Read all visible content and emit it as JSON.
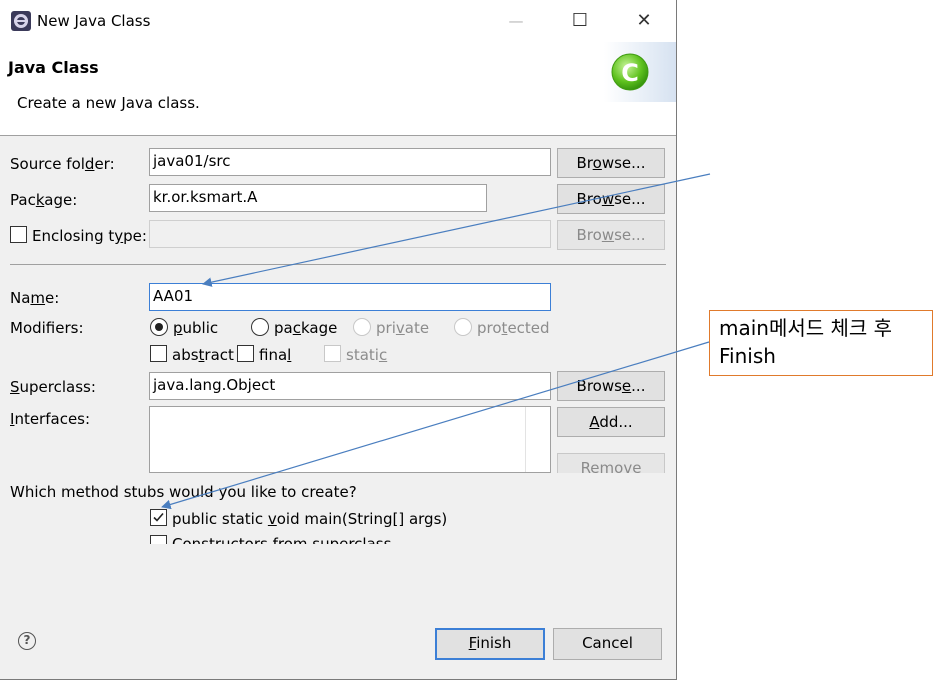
{
  "window": {
    "title": "New Java Class",
    "controls": {
      "minimize": "—",
      "maximize": "☐",
      "close": "✕"
    }
  },
  "header": {
    "title": "Java Class",
    "description": "Create a new Java class."
  },
  "form": {
    "source_folder": {
      "label": "Source folder:",
      "value": "java01/src",
      "browse": "Browse..."
    },
    "package": {
      "label": "Package:",
      "value": "kr.or.ksmart.A",
      "browse": "Browse..."
    },
    "enclosing_type": {
      "label": "Enclosing type:",
      "value": "",
      "browse": "Browse...",
      "checked": false
    },
    "name": {
      "label": "Name:",
      "value": "AA01"
    },
    "modifiers": {
      "label": "Modifiers:",
      "access": [
        {
          "label": "public",
          "selected": true,
          "enabled": true
        },
        {
          "label": "package",
          "selected": false,
          "enabled": true
        },
        {
          "label": "private",
          "selected": false,
          "enabled": false
        },
        {
          "label": "protected",
          "selected": false,
          "enabled": false
        }
      ],
      "flags": [
        {
          "label": "abstract",
          "checked": false,
          "enabled": true
        },
        {
          "label": "final",
          "checked": false,
          "enabled": true
        },
        {
          "label": "static",
          "checked": false,
          "enabled": false
        }
      ]
    },
    "superclass": {
      "label": "Superclass:",
      "value": "java.lang.Object",
      "browse": "Browse..."
    },
    "interfaces": {
      "label": "Interfaces:",
      "add": "Add...",
      "remove": "Remove"
    },
    "stubs": {
      "question": "Which method stubs would you like to create?",
      "items": [
        {
          "label": "public static void main(String[] args)",
          "checked": true
        },
        {
          "label": "Constructors from superclass",
          "checked": false
        }
      ]
    }
  },
  "footer": {
    "finish": "Finish",
    "cancel": "Cancel",
    "help": "?"
  },
  "annotation": {
    "callout_line1": "main메서드 체크 후",
    "callout_line2": "Finish",
    "color": "#e07a2c",
    "arrow_color": "#4a7ebf"
  },
  "colors": {
    "focus": "#3c7fd6",
    "dialog_bg": "#f0f0f0"
  }
}
